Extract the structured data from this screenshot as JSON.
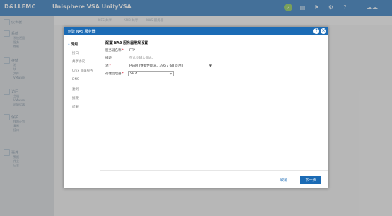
{
  "app": {
    "brand": "D&LLEMC",
    "title": "Unisphere VSA UnityVSA"
  },
  "sidebar": {
    "sections": [
      {
        "title": "仪表板",
        "items": []
      },
      {
        "title": "系统",
        "items": [
          "系统视图",
          "服务",
          "性能"
        ]
      },
      {
        "title": "存储",
        "items": [
          "池",
          "块",
          "文件",
          "VMware"
        ]
      },
      {
        "title": "访问",
        "items": [
          "主机",
          "VMware",
          "初始化器"
        ]
      },
      {
        "title": "保护",
        "items": [
          "快照计划",
          "复制",
          "接口"
        ]
      },
      {
        "title": "事件",
        "items": [
          "警报",
          "作业",
          "日志"
        ]
      }
    ]
  },
  "subtabs": [
    "NFS 共享",
    "SMB 共享",
    "NAS 服务器"
  ],
  "dialog": {
    "title": "创建 NAS 服务器",
    "steps": [
      {
        "label": "常规",
        "active": true
      },
      {
        "label": "接口",
        "active": false
      },
      {
        "label": "共享协议",
        "active": false
      },
      {
        "label": "Unix 目录服务",
        "active": false
      },
      {
        "label": "DNS",
        "active": false
      },
      {
        "label": "复制",
        "active": false
      },
      {
        "label": "摘要",
        "active": false
      },
      {
        "label": "结果",
        "active": false
      }
    ],
    "section_title": "配置 NAS 服务器常规设置",
    "fields": {
      "server_name": {
        "label": "服务器名称",
        "required": true,
        "value": "FTP"
      },
      "description": {
        "label": "描述",
        "required": false,
        "placeholder": "在此处输入描述。"
      },
      "pool": {
        "label": "池",
        "required": true,
        "value": "Pool0 (性能性能层，396.7 GB 可用)"
      },
      "storage_processor": {
        "label": "存储处理器",
        "required": true,
        "value": "SP A"
      }
    },
    "footer": {
      "cancel_label": "取消",
      "next_label": "下一步"
    }
  },
  "colors": {
    "accent": "#1b6bb5",
    "sidebar": "#cfd3d7",
    "status": "#7cc142"
  }
}
